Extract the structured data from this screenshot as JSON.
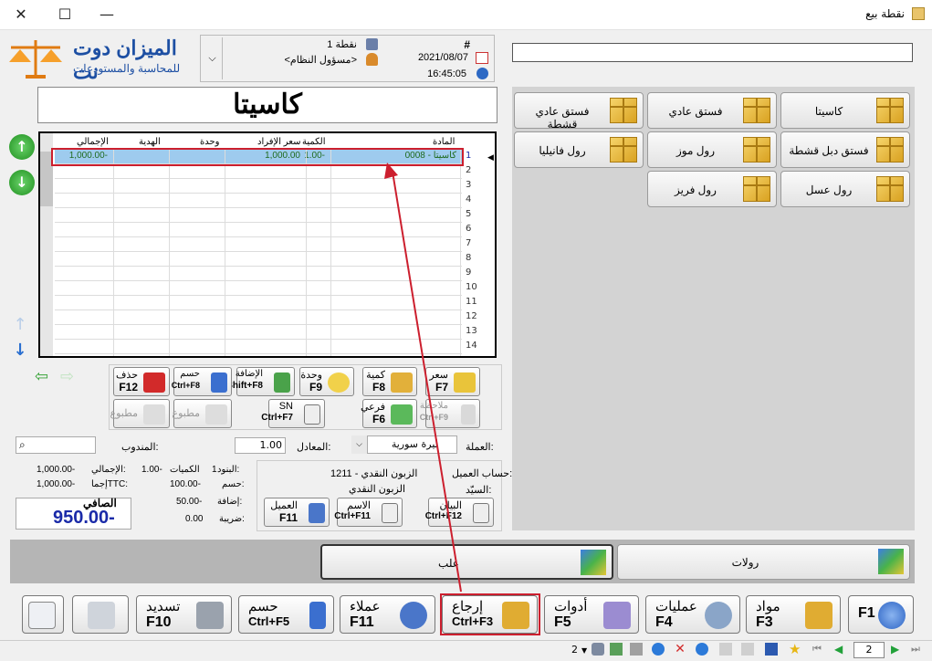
{
  "window": {
    "title": "نقطة بيع"
  },
  "logo": {
    "brand": "الميزان دوت نت",
    "tagline": "للمحاسبة والمستودعات"
  },
  "info": {
    "hash_label": "#",
    "pos_name": "نقطة 1",
    "user_name": "<مسؤول النظام>",
    "date": "2021/08/07",
    "time": "16:45:05"
  },
  "search": {
    "value": ""
  },
  "selected_product": "كاسيتا",
  "products": [
    {
      "label": "كاسيتا"
    },
    {
      "label": "فستق عادي"
    },
    {
      "label": "فستق عادي قشطة"
    },
    {
      "label": "فستق دبل قشطة"
    },
    {
      "label": "رول موز"
    },
    {
      "label": "رول فانيليا"
    },
    {
      "label": "رول عسل"
    },
    {
      "label": "رول فريز"
    }
  ],
  "grid": {
    "headers": {
      "item": "المادة",
      "qty": "الكمية",
      "price": "سعر الإفراد",
      "unit": "وحدة",
      "gift": "الهدية",
      "total": "الإجمالي"
    },
    "rows": [
      {
        "num": "1",
        "item": "0008 - كاسيتا",
        "qty": "1.00-",
        "price": "1,000.00",
        "unit": "",
        "gift": "",
        "total": "1,000.00-"
      },
      {
        "num": "2"
      },
      {
        "num": "3"
      },
      {
        "num": "4"
      },
      {
        "num": "5"
      },
      {
        "num": "6"
      },
      {
        "num": "7"
      },
      {
        "num": "8"
      },
      {
        "num": "9"
      },
      {
        "num": "10"
      },
      {
        "num": "11"
      },
      {
        "num": "12"
      },
      {
        "num": "13"
      },
      {
        "num": "14"
      }
    ]
  },
  "actions": {
    "price": {
      "a": "سعر",
      "b": "F7"
    },
    "qty": {
      "a": "كمية",
      "b": "F8"
    },
    "unit": {
      "a": "وحدة",
      "b": "F9"
    },
    "add": {
      "a": "الإضافة",
      "b": "Shift+F8"
    },
    "discount": {
      "a": "حسم",
      "b": "Ctrl+F8"
    },
    "delete": {
      "a": "حذف",
      "b": "F12"
    },
    "note": {
      "a": "ملاحظة",
      "b": "Ctrl+F9"
    },
    "sub": {
      "a": "فرعي",
      "b": "F6"
    },
    "sn": {
      "a": "SN",
      "b": "Ctrl+F7"
    },
    "printed1": "مطبوع",
    "printed2": "مطبوع"
  },
  "currency": {
    "label": "العملة:",
    "value": "ليرة سورية",
    "rate_label": "المعادل:",
    "rate": "1.00",
    "rep_label": "المندوب:"
  },
  "customer": {
    "account_label": "حساب العميل:",
    "account": "1211 - الزبون النقدي",
    "mr_label": "السيّد:",
    "mr": "الزبون النقدي",
    "btn_statement": {
      "a": "البيان",
      "b": "Ctrl+F12"
    },
    "btn_name": {
      "a": "الاسم",
      "b": "Ctrl+F11"
    },
    "btn_customer": {
      "a": "العميل",
      "b": "F11"
    }
  },
  "totals": {
    "items_label": "البنود:",
    "items": "1",
    "qtys_label": "الكميات",
    "qtys": "1.00-",
    "disc_label": "حسم:",
    "disc": "100.00-",
    "add_label": "إضافة:",
    "add": "50.00-",
    "tax_label": "ضريبة:",
    "tax": "0.00",
    "total_label": "الإجمالي:",
    "total": "1,000.00-",
    "ttc_label": "إجماTTC:",
    "ttc": "1,000.00-",
    "net_label": "الصافي",
    "net": "950.00-"
  },
  "groups": {
    "rolls": "رولات",
    "cones": "علب"
  },
  "bottom": {
    "f1": {
      "a": "",
      "b": "F1"
    },
    "items": {
      "a": "مواد",
      "b": "F3"
    },
    "ops": {
      "a": "عمليات",
      "b": "F4"
    },
    "tools": {
      "a": "أدوات",
      "b": "F5"
    },
    "return": {
      "a": "إرجاع",
      "b": "Ctrl+F3"
    },
    "clients": {
      "a": "عملاء",
      "b": "F11"
    },
    "discount": {
      "a": "حسم",
      "b": "Ctrl+F5"
    },
    "pay": {
      "a": "تسديد",
      "b": "F10"
    }
  },
  "status": {
    "count": "2",
    "page": "2"
  },
  "colors": {
    "highlight": "#cc1f2e",
    "row_select": "#9ecbee",
    "net": "#1a2aa8"
  }
}
